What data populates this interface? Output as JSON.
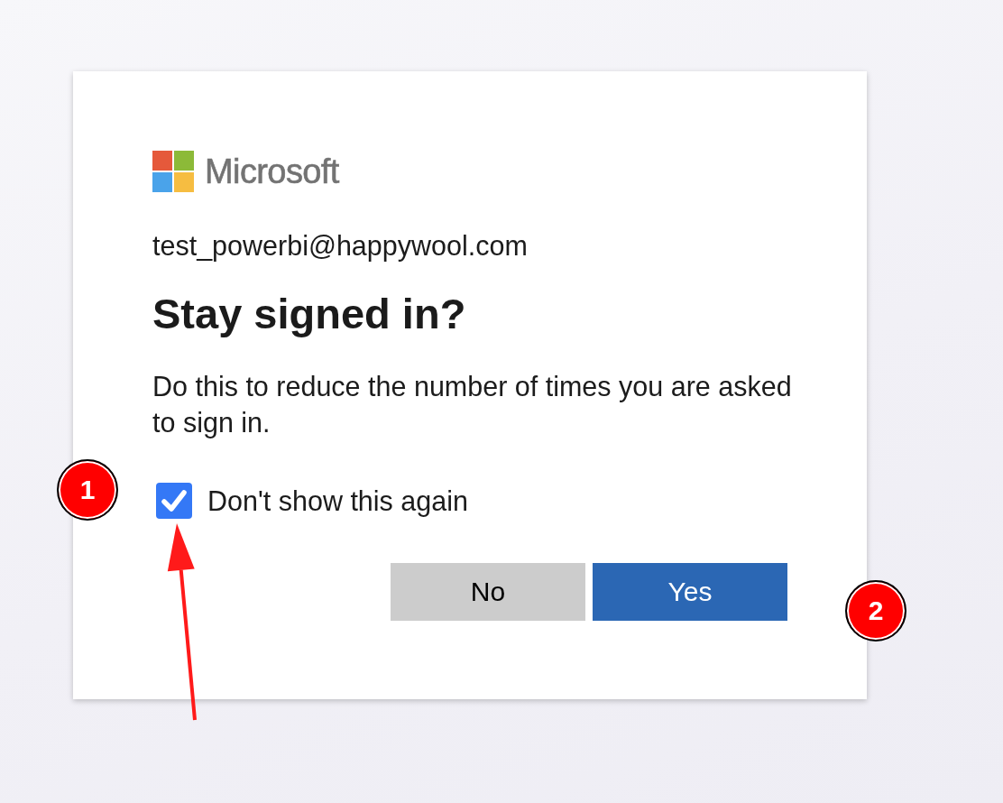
{
  "brand": {
    "name": "Microsoft"
  },
  "account": "test_powerbi@happywool.com",
  "title": "Stay signed in?",
  "message": "Do this to reduce the number of times you are asked to sign in.",
  "checkbox": {
    "label": "Don't show this again",
    "checked": true
  },
  "buttons": [
    {
      "label": "No",
      "kind": "secondary"
    },
    {
      "label": "Yes",
      "kind": "primary"
    }
  ],
  "annotations": [
    {
      "label": "1",
      "kind": "badge"
    },
    {
      "label": "2",
      "kind": "badge"
    }
  ]
}
